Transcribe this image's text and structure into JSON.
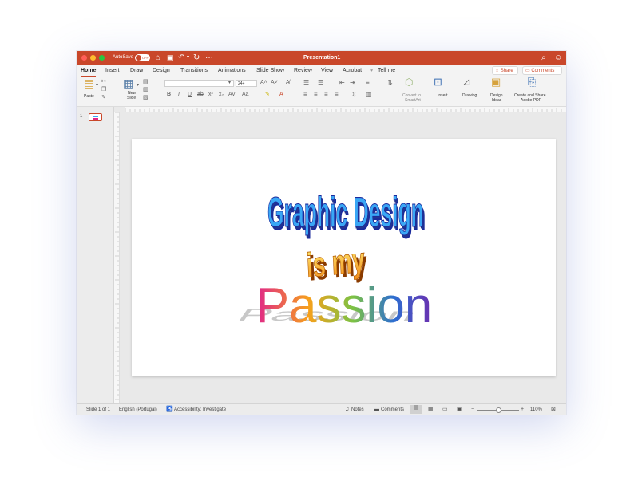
{
  "titlebar": {
    "autosave_label": "AutoSave",
    "autosave_state": "OFF",
    "title": "Presentation1",
    "icons": [
      "home-icon",
      "save-icon",
      "undo-icon",
      "redo-icon",
      "more-icon",
      "search-icon",
      "account-icon"
    ]
  },
  "tabs": [
    {
      "label": "Home",
      "active": true
    },
    {
      "label": "Insert"
    },
    {
      "label": "Draw"
    },
    {
      "label": "Design"
    },
    {
      "label": "Transitions"
    },
    {
      "label": "Animations"
    },
    {
      "label": "Slide Show"
    },
    {
      "label": "Review"
    },
    {
      "label": "View"
    },
    {
      "label": "Acrobat"
    },
    {
      "label": "Tell me"
    }
  ],
  "share_label": "Share",
  "comments_label": "Comments",
  "ribbon": {
    "paste": "Paste",
    "new_slide_1": "New",
    "new_slide_2": "Slide",
    "font_name": "",
    "font_size": "24+",
    "convert_1": "Convert to",
    "convert_2": "SmartArt",
    "insert": "Insert",
    "drawing": "Drawing",
    "design_ideas_1": "Design",
    "design_ideas_2": "Ideas",
    "create_share_1": "Create and Share",
    "create_share_2": "Adobe PDF"
  },
  "slide_pane": {
    "number": "1"
  },
  "slide": {
    "line1": "Graphic Design",
    "line2": "is my",
    "line3": "Passion",
    "line1_color": "#3aa7f5",
    "line1_outline": "#1b2a9c",
    "line2_color": "#f7a71b",
    "line3_colors": [
      "#e0258a",
      "#f6a11c",
      "#7cc244",
      "#2d6fd1",
      "#6b2fb0"
    ]
  },
  "status": {
    "slide_info": "Slide 1 of 1",
    "language": "English (Portugal)",
    "accessibility": "Accessibility: Investigate",
    "notes": "Notes",
    "comments": "Comments",
    "zoom": "110%"
  },
  "colors": {
    "accent": "#c9472a"
  }
}
